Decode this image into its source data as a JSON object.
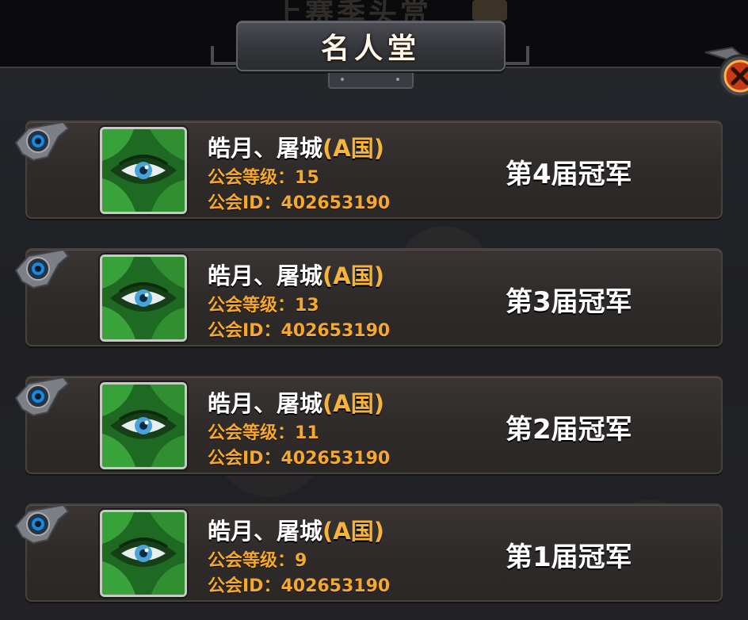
{
  "background_header": "上赛季头赏",
  "title": "名人堂",
  "colors": {
    "name_white": "#ffffff",
    "accent_orange": "#f5a82c",
    "panel_dark": "#24262b",
    "avatar_green": "#2d7a2a"
  },
  "rows": [
    {
      "name": "皓月、屠城",
      "nation": "(A国)",
      "guild_level_label": "公会等级：",
      "guild_level": "15",
      "guild_id_label": "公会ID：",
      "guild_id": "402653190",
      "championship": "第4届冠军",
      "avatar_icon": "green-leaf-eye-icon"
    },
    {
      "name": "皓月、屠城",
      "nation": "(A国)",
      "guild_level_label": "公会等级：",
      "guild_level": "13",
      "guild_id_label": "公会ID：",
      "guild_id": "402653190",
      "championship": "第3届冠军",
      "avatar_icon": "green-leaf-eye-icon"
    },
    {
      "name": "皓月、屠城",
      "nation": "(A国)",
      "guild_level_label": "公会等级：",
      "guild_level": "11",
      "guild_id_label": "公会ID：",
      "guild_id": "402653190",
      "championship": "第2届冠军",
      "avatar_icon": "green-leaf-eye-icon"
    },
    {
      "name": "皓月、屠城",
      "nation": "(A国)",
      "guild_level_label": "公会等级：",
      "guild_level": "9",
      "guild_id_label": "公会ID：",
      "guild_id": "402653190",
      "championship": "第1届冠军",
      "avatar_icon": "green-leaf-eye-icon"
    }
  ]
}
